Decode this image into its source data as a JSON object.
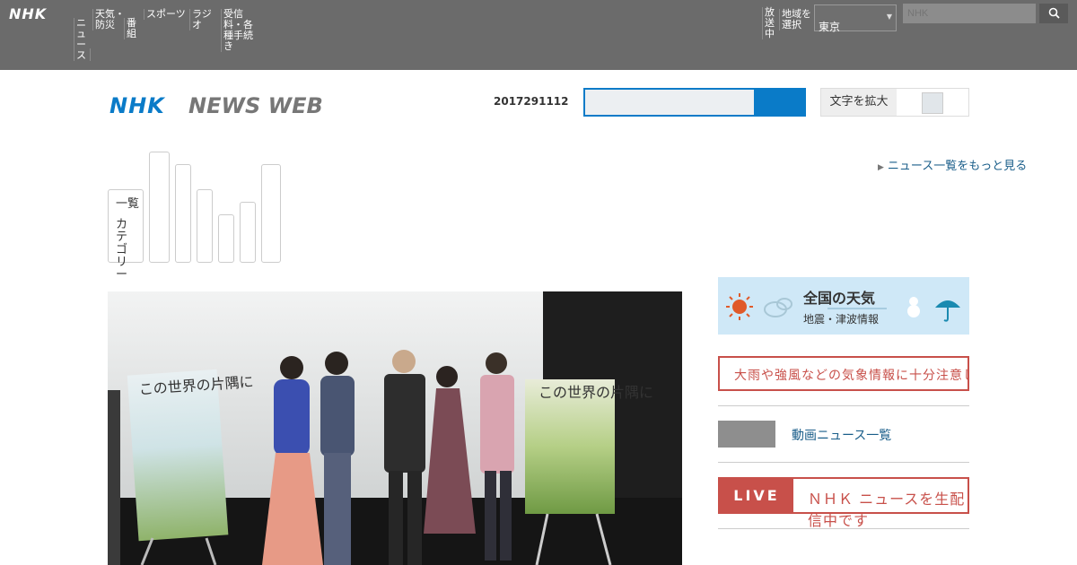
{
  "topbar": {
    "logo": "NHK",
    "nav_items": [
      "ニュース",
      "天気・防災",
      "番組",
      "スポーツ",
      "ラジオ",
      "受信料・各種手続き"
    ],
    "right_items": [
      "放送中",
      "地域を選択"
    ],
    "region_value": "東京",
    "search_placeholder": "NHK"
  },
  "header": {
    "logo_text": "NHK NEWS WEB",
    "date_code": "2017291112",
    "toggle_label": "文字を拡大"
  },
  "tabs": {
    "first_line1": "一覧",
    "first_line2": "カテゴリー"
  },
  "more_link": "ニュース一覧をもっと見る",
  "photo": {
    "poster_left_title": "この世界の片隅に",
    "poster_right_title": "この世界の片隅に"
  },
  "sidebar": {
    "weather_title": "全国の天気",
    "weather_sub": "地震・津波情報",
    "notice_text": "大雨や強風などの気象情報に十分注意してください",
    "video_label": "動画ニュース一覧",
    "live_tag": "LIVE",
    "live_text": "ＮＨＫ ニュースを生配信中です"
  },
  "colors": {
    "topbar": "#6b6b6b",
    "accent_blue": "#0a7bc8",
    "alert_red": "#c8504a",
    "link": "#1a5e8a"
  }
}
